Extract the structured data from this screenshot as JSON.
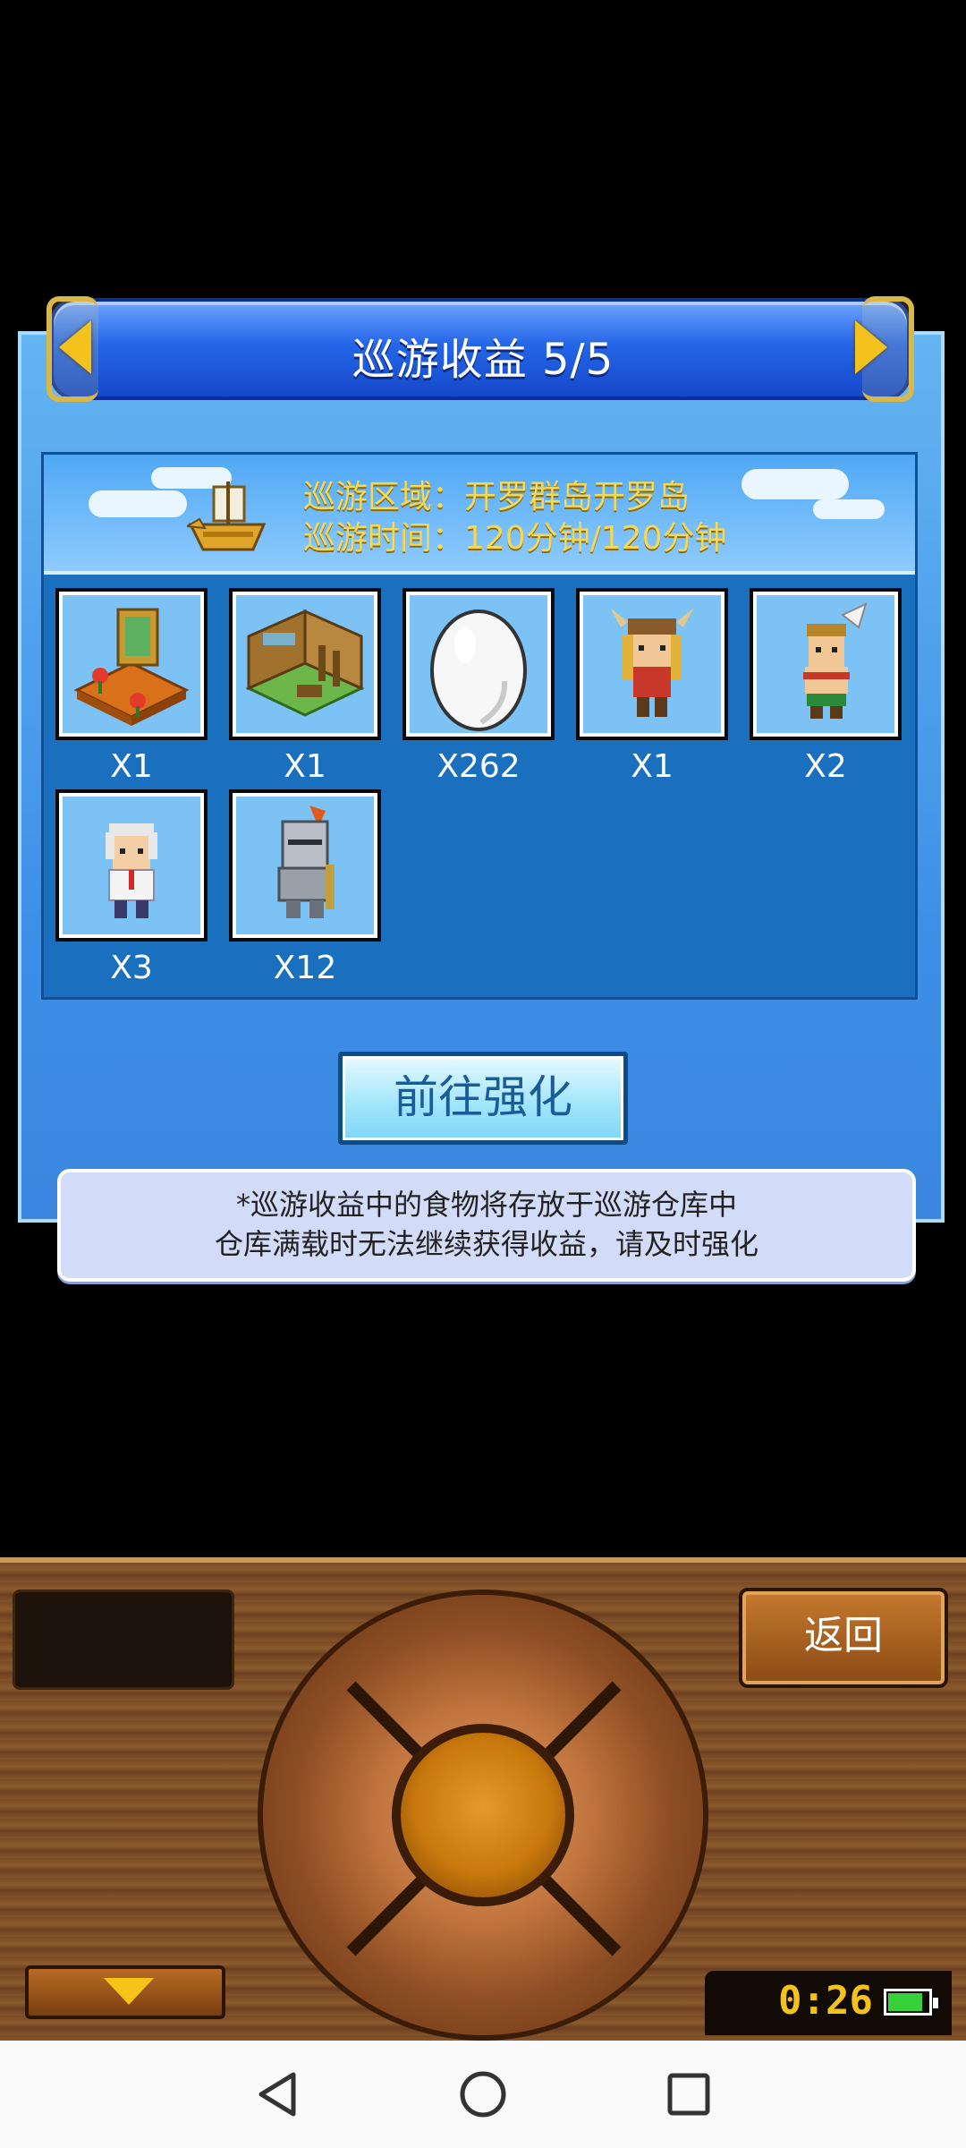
{
  "header": {
    "title": "巡游收益 5/5"
  },
  "cruise": {
    "area_line": "巡游区域：开罗群岛开罗岛",
    "time_line": "巡游时间：120分钟/120分钟"
  },
  "rewards": [
    {
      "icon": "garden-room-icon",
      "count": "X1"
    },
    {
      "icon": "wooden-room-icon",
      "count": "X1"
    },
    {
      "icon": "egg-icon",
      "count": "X262"
    },
    {
      "icon": "viking-character-icon",
      "count": "X1"
    },
    {
      "icon": "feather-warrior-character-icon",
      "count": "X2"
    },
    {
      "icon": "old-man-character-icon",
      "count": "X3"
    },
    {
      "icon": "knight-character-icon",
      "count": "X12"
    }
  ],
  "actions": {
    "strengthen_label": "前往强化"
  },
  "note": {
    "line1": "*巡游收益中的食物将存放于巡游仓库中",
    "line2": "仓库满载时无法继续获得收益，请及时强化"
  },
  "controller": {
    "back_label": "返回",
    "time": "0:26"
  },
  "colors": {
    "title_blue": "#2566e8",
    "gold": "#f3c21d",
    "info_yellow": "#f4d85a",
    "battery_green": "#39d13a"
  }
}
